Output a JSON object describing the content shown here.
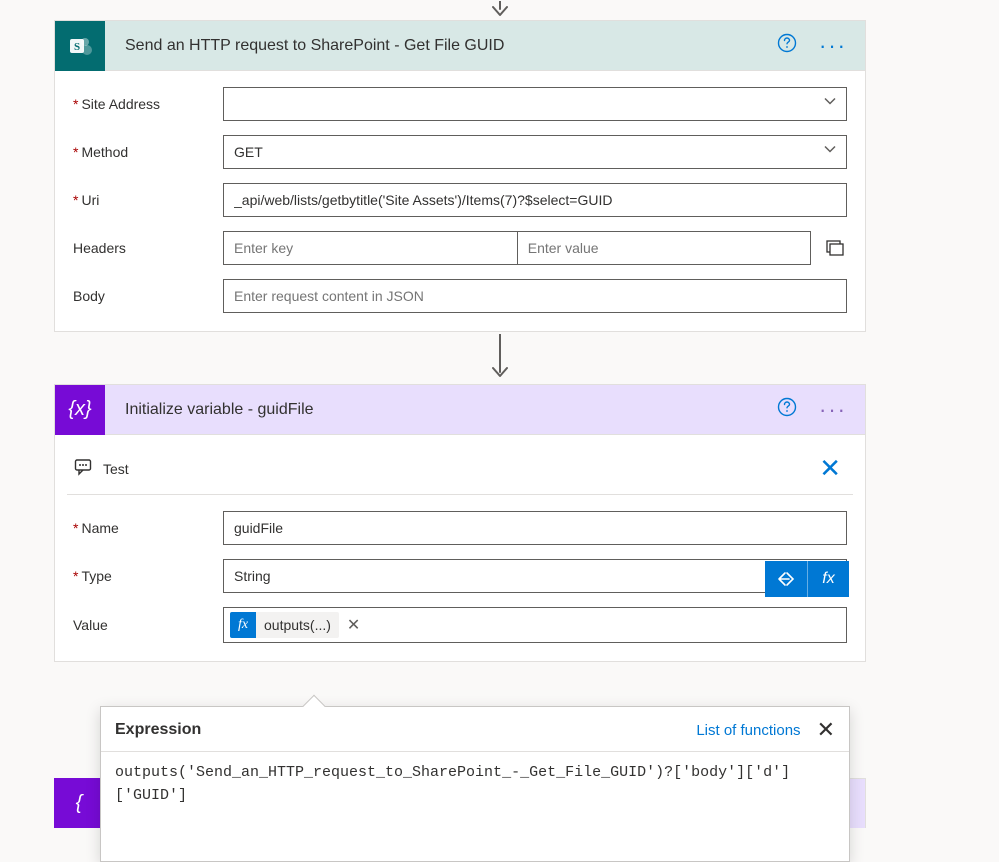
{
  "cards": {
    "sp": {
      "title": "Send an HTTP request to SharePoint - Get File GUID",
      "fields": {
        "siteAddress": {
          "label": "Site Address",
          "value": ""
        },
        "method": {
          "label": "Method",
          "value": "GET"
        },
        "uri": {
          "label": "Uri",
          "value": "_api/web/lists/getbytitle('Site Assets')/Items(7)?$select=GUID"
        },
        "headers": {
          "label": "Headers",
          "keyPlaceholder": "Enter key",
          "valuePlaceholder": "Enter value"
        },
        "body": {
          "label": "Body",
          "placeholder": "Enter request content in JSON"
        }
      }
    },
    "var": {
      "title": "Initialize variable - guidFile",
      "test": {
        "label": "Test"
      },
      "fields": {
        "name": {
          "label": "Name",
          "value": "guidFile"
        },
        "type": {
          "label": "Type",
          "value": "String"
        },
        "value": {
          "label": "Value",
          "token": {
            "badge": "fx",
            "text": "outputs(...)"
          }
        }
      }
    }
  },
  "expression": {
    "title": "Expression",
    "linkText": "List of functions",
    "code": "outputs('Send_an_HTTP_request_to_SharePoint_-_Get_File_GUID')?['body']['d']['GUID']"
  }
}
